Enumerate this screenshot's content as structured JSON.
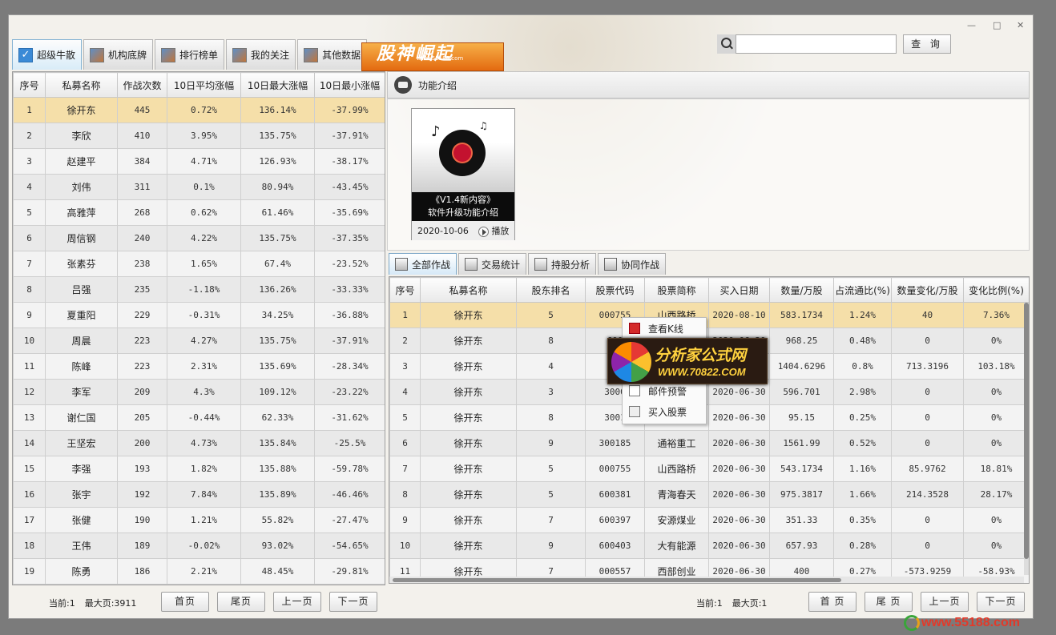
{
  "window_controls": [
    "—",
    "□",
    "✕"
  ],
  "left_tabs": [
    {
      "label": "超级牛散",
      "icon": "check-icon",
      "active": true
    },
    {
      "label": "机构底牌",
      "icon": "chart-icon",
      "active": false
    },
    {
      "label": "排行榜单",
      "icon": "ranking-icon",
      "active": false
    },
    {
      "label": "我的关注",
      "icon": "user-icon",
      "active": false
    },
    {
      "label": "其他数据",
      "icon": "film-icon",
      "active": false
    }
  ],
  "banner": {
    "title": "股神崛起",
    "url": "www.55188.com"
  },
  "search": {
    "value": "",
    "placeholder": "",
    "button_label": "查 询"
  },
  "left_table": {
    "headers": [
      "序号",
      "私募名称",
      "作战次数",
      "10日平均涨幅",
      "10日最大涨幅",
      "10日最小涨幅"
    ],
    "rows": [
      [
        "1",
        "徐开东",
        "445",
        "0.72%",
        "136.14%",
        "-37.99%"
      ],
      [
        "2",
        "李欣",
        "410",
        "3.95%",
        "135.75%",
        "-37.91%"
      ],
      [
        "3",
        "赵建平",
        "384",
        "4.71%",
        "126.93%",
        "-38.17%"
      ],
      [
        "4",
        "刘伟",
        "311",
        "0.1%",
        "80.94%",
        "-43.45%"
      ],
      [
        "5",
        "高雅萍",
        "268",
        "0.62%",
        "61.46%",
        "-35.69%"
      ],
      [
        "6",
        "周信钢",
        "240",
        "4.22%",
        "135.75%",
        "-37.35%"
      ],
      [
        "7",
        "张素芬",
        "238",
        "1.65%",
        "67.4%",
        "-23.52%"
      ],
      [
        "8",
        "吕强",
        "235",
        "-1.18%",
        "136.26%",
        "-33.33%"
      ],
      [
        "9",
        "夏重阳",
        "229",
        "-0.31%",
        "34.25%",
        "-36.88%"
      ],
      [
        "10",
        "周晨",
        "223",
        "4.27%",
        "135.75%",
        "-37.91%"
      ],
      [
        "11",
        "陈峰",
        "223",
        "2.31%",
        "135.69%",
        "-28.34%"
      ],
      [
        "12",
        "李军",
        "209",
        "4.3%",
        "109.12%",
        "-23.22%"
      ],
      [
        "13",
        "谢仁国",
        "205",
        "-0.44%",
        "62.33%",
        "-31.62%"
      ],
      [
        "14",
        "王坚宏",
        "200",
        "4.73%",
        "135.84%",
        "-25.5%"
      ],
      [
        "15",
        "李强",
        "193",
        "1.82%",
        "135.88%",
        "-59.78%"
      ],
      [
        "16",
        "张宇",
        "192",
        "7.84%",
        "135.89%",
        "-46.46%"
      ],
      [
        "17",
        "张健",
        "190",
        "1.21%",
        "55.82%",
        "-27.47%"
      ],
      [
        "18",
        "王伟",
        "189",
        "-0.02%",
        "93.02%",
        "-54.65%"
      ],
      [
        "19",
        "陈勇",
        "186",
        "2.21%",
        "48.45%",
        "-29.81%"
      ]
    ]
  },
  "left_pager": {
    "current": "当前:1",
    "max": "最大页:3911",
    "first": "首页",
    "last": "尾页",
    "prev": "上一页",
    "next": "下一页"
  },
  "feature": {
    "header_label": "功能介绍",
    "card_title": "《V1.4新内容》",
    "card_subtitle": "软件升级功能介绍",
    "card_date": "2020-10-06",
    "play_label": "播放"
  },
  "right_tabs": [
    {
      "label": "全部作战",
      "icon": "list-icon",
      "active": true
    },
    {
      "label": "交易统计",
      "icon": "stats-icon",
      "active": false
    },
    {
      "label": "持股分析",
      "icon": "analysis-icon",
      "active": false
    },
    {
      "label": "协同作战",
      "icon": "collab-icon",
      "active": false
    }
  ],
  "right_table": {
    "headers": [
      "序号",
      "私募名称",
      "股东排名",
      "股票代码",
      "股票简称",
      "买入日期",
      "数量/万股",
      "占流通比(%)",
      "数量变化/万股",
      "变化比例(%)"
    ],
    "rows": [
      [
        "1",
        "徐开东",
        "5",
        "000755",
        "山西路桥",
        "2020-08-10",
        "583.1734",
        "1.24%",
        "40",
        "7.36%"
      ],
      [
        "2",
        "徐开东",
        "8",
        "600",
        "",
        "2020-06-30",
        "968.25",
        "0.48%",
        "0",
        "0%"
      ],
      [
        "3",
        "徐开东",
        "4",
        "6",
        "",
        "2020-06-30",
        "1404.6296",
        "0.8%",
        "713.3196",
        "103.18%"
      ],
      [
        "4",
        "徐开东",
        "3",
        "3000",
        "",
        "2020-06-30",
        "596.701",
        "2.98%",
        "0",
        "0%"
      ],
      [
        "5",
        "徐开东",
        "8",
        "3001",
        "",
        "2020-06-30",
        "95.15",
        "0.25%",
        "0",
        "0%"
      ],
      [
        "6",
        "徐开东",
        "9",
        "300185",
        "通裕重工",
        "2020-06-30",
        "1561.99",
        "0.52%",
        "0",
        "0%"
      ],
      [
        "7",
        "徐开东",
        "5",
        "000755",
        "山西路桥",
        "2020-06-30",
        "543.1734",
        "1.16%",
        "85.9762",
        "18.81%"
      ],
      [
        "8",
        "徐开东",
        "5",
        "600381",
        "青海春天",
        "2020-06-30",
        "975.3817",
        "1.66%",
        "214.3528",
        "28.17%"
      ],
      [
        "9",
        "徐开东",
        "7",
        "600397",
        "安源煤业",
        "2020-06-30",
        "351.33",
        "0.35%",
        "0",
        "0%"
      ],
      [
        "10",
        "徐开东",
        "9",
        "600403",
        "大有能源",
        "2020-06-30",
        "657.93",
        "0.28%",
        "0",
        "0%"
      ],
      [
        "11",
        "徐开东",
        "7",
        "000557",
        "西部创业",
        "2020-06-30",
        "400",
        "0.27%",
        "-573.9259",
        "-58.93%"
      ]
    ]
  },
  "context_menu": [
    {
      "label": "查看K线",
      "icon": "kline-icon"
    },
    {
      "label": "",
      "icon": ""
    },
    {
      "label": "",
      "icon": ""
    },
    {
      "label": "邮件预警",
      "icon": "mail-icon"
    },
    {
      "label": "买入股票",
      "icon": "buy-icon"
    }
  ],
  "watermark": {
    "title": "分析家公式网",
    "url": "WWW.70822.COM"
  },
  "right_pager": {
    "current": "当前:1",
    "max": "最大页:1",
    "first": "首 页",
    "last": "尾 页",
    "prev": "上一页",
    "next": "下一页"
  },
  "brand_footer": "www.55188.com",
  "colors": {
    "selected_row": "#f5dfa9",
    "accent_blue": "#3b8ad6",
    "banner_orange": "#e36a10",
    "watermark_gold": "#ffd23f"
  }
}
